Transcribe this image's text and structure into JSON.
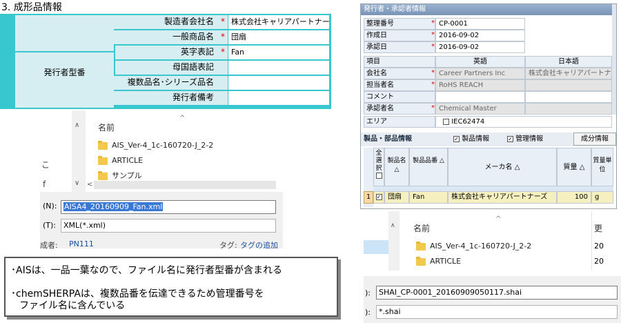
{
  "panel_a": {
    "section_title": "3. 成形品情報",
    "rows": [
      {
        "label": "製造者会社名",
        "required": true,
        "value": "株式会社キャリアパートナーズ"
      },
      {
        "label": "一般商品名",
        "required": true,
        "value": "団扇"
      },
      {
        "label": "英字表記",
        "required": true,
        "value": "Fan"
      },
      {
        "label": "母国語表記",
        "required": false,
        "value": ""
      },
      {
        "label": "複数品名･シリーズ品名",
        "required": false,
        "value": ""
      },
      {
        "label": "発行者備考",
        "required": false,
        "value": ""
      }
    ],
    "group_label": "発行者型番",
    "required_mark": "*"
  },
  "panel_b": {
    "header": "発行者・承認者情報",
    "fields": [
      {
        "label": "整理番号",
        "value": "CP-0001"
      },
      {
        "label": "作成日",
        "value": "2016-09-02"
      },
      {
        "label": "承認日",
        "value": "2016-09-02"
      }
    ],
    "col_item": "項目",
    "col_en": "英語",
    "col_ja": "日本語",
    "rows": [
      {
        "label": "会社名",
        "en": "Career Partners Inc",
        "ja": "株式会社キャリアパートナーズ"
      },
      {
        "label": "担当者名",
        "en": "RoHS REACH",
        "ja": ""
      },
      {
        "label": "コメント",
        "en": "",
        "ja": ""
      },
      {
        "label": "承認者名",
        "en": "Chemical Master",
        "ja": ""
      }
    ],
    "area_label": "エリア",
    "area_value": "IEC62474",
    "product_header": "製品・部品情報",
    "check_product": "製品情報",
    "check_manage": "管理情報",
    "component_button": "成分情報",
    "grid_headers": {
      "select_all": "全選択",
      "product_name": "製品名",
      "product_no": "製品品番",
      "maker": "メーカ名",
      "mass": "質量",
      "mass_unit": "質量単位"
    },
    "grid_row": {
      "index": "1",
      "name": "団扇",
      "number": "Fan",
      "maker": "株式会社キャリアパートナーズ",
      "mass": "100",
      "unit": "g"
    },
    "sort_mark": "△"
  },
  "panel_c": {
    "column_name": "名前",
    "items": [
      "AIS_Ver-4_1c-160720-J_2-2",
      "ARTICLE",
      "サンプル"
    ],
    "filename_label": "(N):",
    "filename": "AISA4_20160909_Fan.xml",
    "type_label": "(T):",
    "type_value": "XML(*.xml)",
    "author_label": "成者:",
    "author_value": "PN111",
    "tag_label": "タグ:",
    "tag_value": "タグの追加",
    "side_glyph_1": "こ",
    "side_glyph_2": "f"
  },
  "panel_d": {
    "note1": "･AISは、一品一葉なので、ファイル名に発行者型番が含まれる",
    "note2a": "･chemSHERPAは、複数品番を伝達できるため管理番号を",
    "note2b": "ファイル名に含んでいる"
  },
  "panel_e": {
    "column_name": "名前",
    "column_right": "更",
    "items": [
      "AIS_Ver-4_1c-160720-J_2-2",
      "ARTICLE"
    ],
    "item_dates": [
      "20",
      "20"
    ],
    "filename_label": "):",
    "filename": "SHAI_CP-0001_20160909050117.shai",
    "type_label": "):",
    "type_value": "*.shai"
  }
}
